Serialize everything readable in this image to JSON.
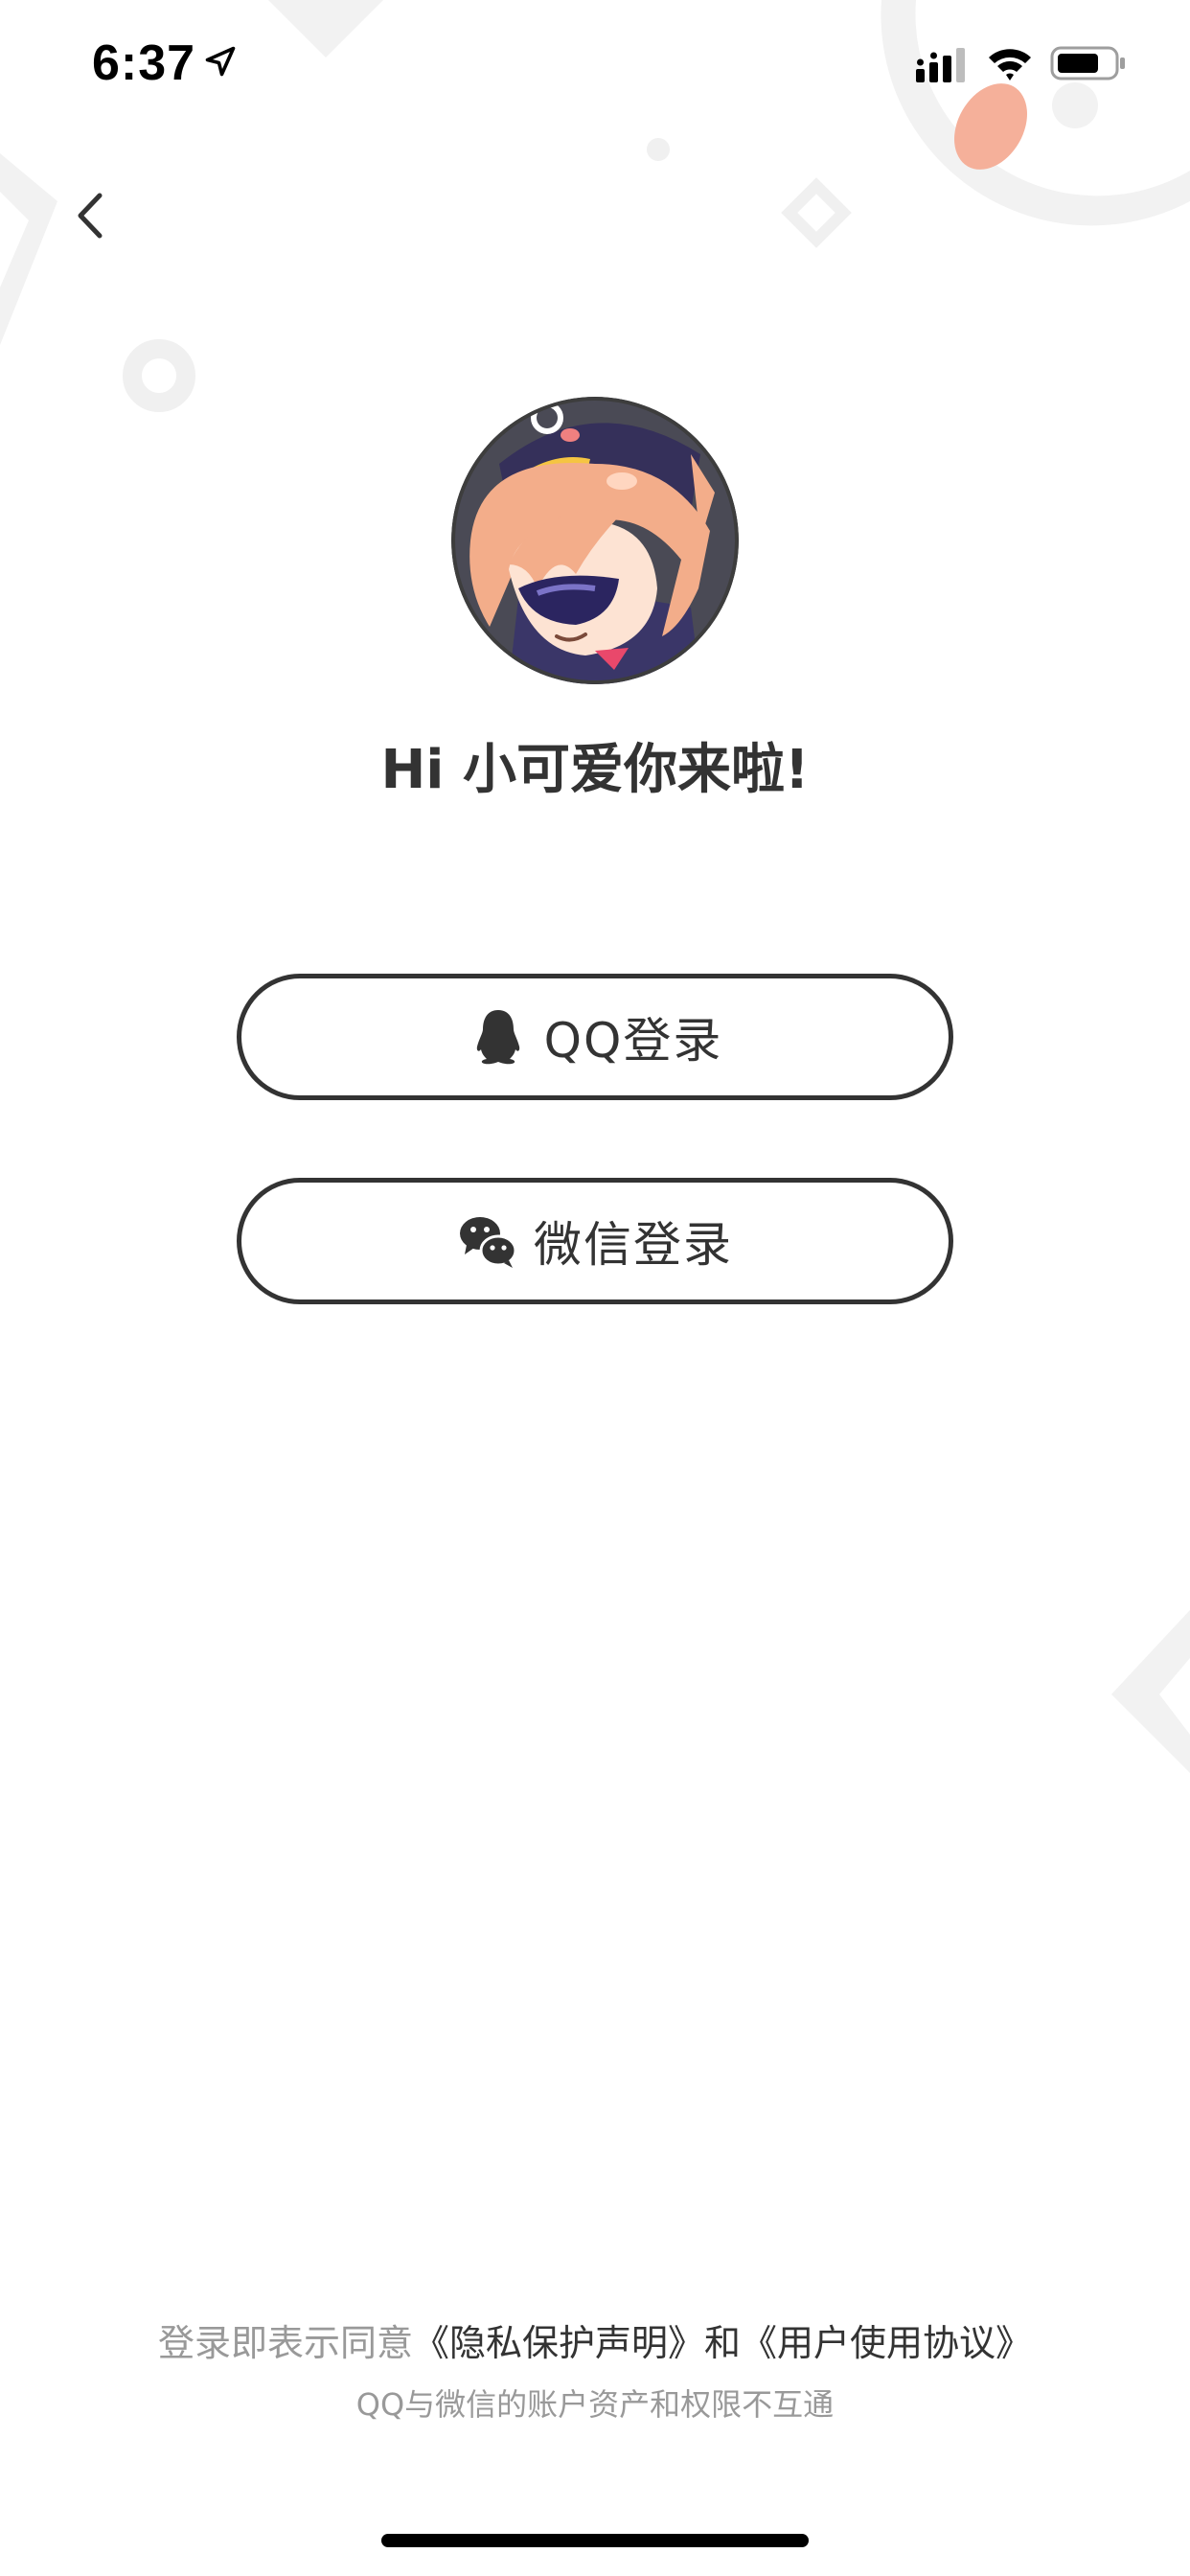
{
  "status_bar": {
    "time": "6:37",
    "icons": [
      "location-arrow-icon",
      "cellular-signal-icon",
      "wifi-icon",
      "battery-icon"
    ]
  },
  "nav": {
    "back_icon": "chevron-left-icon"
  },
  "profile": {
    "greeting": "Hi 小可爱你来啦!",
    "avatar_desc": "avatar"
  },
  "login": {
    "qq_label": "QQ登录",
    "qq_icon": "qq-penguin-icon",
    "wechat_label": "微信登录",
    "wechat_icon": "wechat-icon"
  },
  "legal": {
    "prefix": "登录即表示同意",
    "privacy_link": "《隐私保护声明》",
    "conjunction": "和",
    "agreement_link": "《用户使用协议》",
    "note": "QQ与微信的账户资产和权限不互通"
  },
  "colors": {
    "text_dark": "#333333",
    "text_gray": "#999999",
    "decor_gray": "#f2f2f2",
    "accent_salmon": "#f5b09a",
    "background": "#ffffff"
  }
}
